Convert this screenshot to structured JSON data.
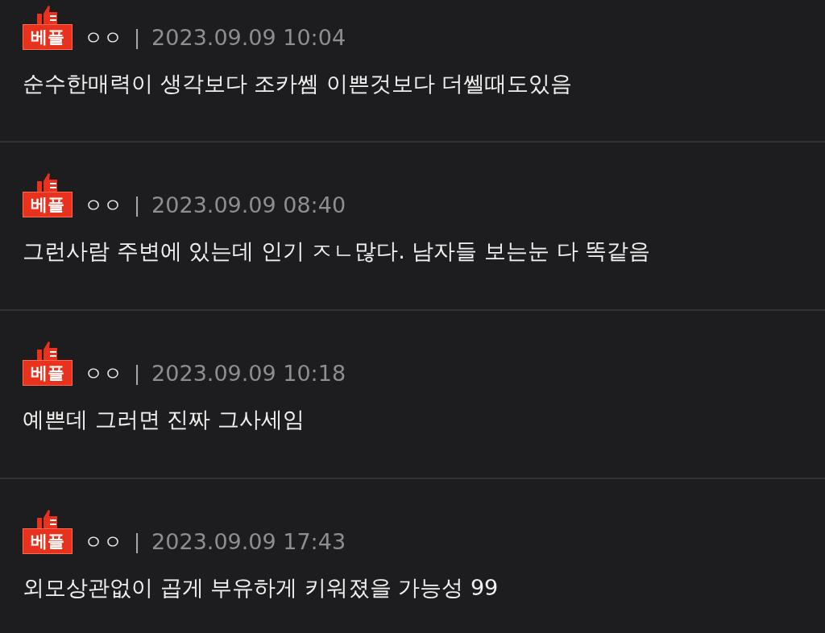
{
  "comments": [
    {
      "badge": "베플",
      "author": "ㅇㅇ",
      "separator": "|",
      "time": "2023.09.09 10:04",
      "text": "순수한매력이 생각보다 조카쎔 이쁜것보다 더쎌때도있음"
    },
    {
      "badge": "베플",
      "author": "ㅇㅇ",
      "separator": "|",
      "time": "2023.09.09 08:40",
      "text": "그런사람 주변에 있는데 인기 ㅈㄴ많다. 남자들 보는눈 다 똑같음"
    },
    {
      "badge": "베플",
      "author": "ㅇㅇ",
      "separator": "|",
      "time": "2023.09.09 10:18",
      "text": "예쁜데 그러면 진짜 그사세임"
    },
    {
      "badge": "베플",
      "author": "ㅇㅇ",
      "separator": "|",
      "time": "2023.09.09 17:43",
      "text": "외모상관없이 곱게 부유하게 키워졌을 가능성 99"
    }
  ]
}
